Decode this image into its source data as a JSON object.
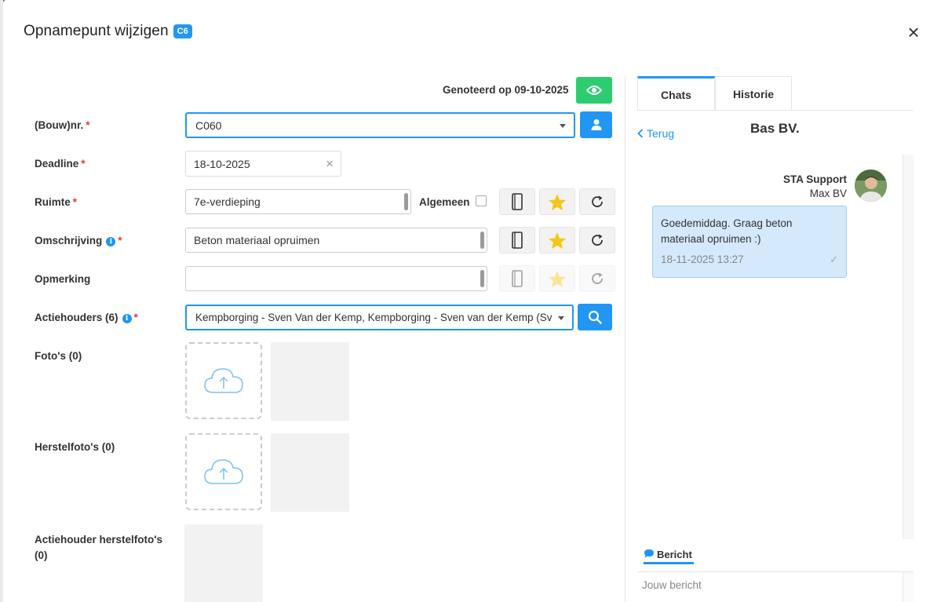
{
  "modal": {
    "title": "Opnamepunt wijzigen",
    "badge": "C6",
    "close_glyph": "×"
  },
  "form": {
    "noted_text": "Genoteerd op 09-10-2025",
    "required_mark": "*",
    "info_glyph": "i",
    "bouwnr": {
      "label": "(Bouw)nr.",
      "value": "C060"
    },
    "deadline": {
      "label": "Deadline",
      "value": "18-10-2025",
      "clear_glyph": "×"
    },
    "ruimte": {
      "label": "Ruimte",
      "value": "7e-verdieping",
      "algemeen_label": "Algemeen"
    },
    "omschrijving": {
      "label": "Omschrijving",
      "value": "Beton materiaal opruimen"
    },
    "opmerking": {
      "label": "Opmerking",
      "value": ""
    },
    "actiehouders": {
      "label": "Actiehouders (6)",
      "value": "Kempborging - Sven Van der Kemp, Kempborging - Sven van der Kemp (Sv"
    },
    "fotos": {
      "label": "Foto's (0)"
    },
    "herstelfotos": {
      "label": "Herstelfoto's (0)"
    },
    "actiehouder_herstelfotos": {
      "label_line1": "Actiehouder herstelfoto's",
      "label_line2": "(0)"
    }
  },
  "chat": {
    "tabs": [
      {
        "label": "Chats",
        "active": true
      },
      {
        "label": "Historie",
        "active": false
      }
    ],
    "back_label": "Terug",
    "title": "Bas BV.",
    "message": {
      "sender_name": "STA Support",
      "sender_company": "Max BV",
      "text": "Goedemiddag. Graag beton materiaal opruimen :)",
      "timestamp": "18-11-2025 13:27",
      "status_glyph": "✓"
    },
    "compose": {
      "tab_label": "Bericht",
      "placeholder": "Jouw bericht"
    }
  },
  "colors": {
    "accent": "#2196f3",
    "success": "#2ecc71",
    "star": "#f5c518",
    "required": "#e53935",
    "bubble_bg": "#d4e9fb"
  },
  "icons": [
    "close-icon",
    "eye-icon",
    "user-icon",
    "search-icon",
    "book-icon",
    "star-icon",
    "reload-icon",
    "cloud-upload-icon",
    "chevron-left-icon",
    "chat-icon",
    "check-icon"
  ]
}
